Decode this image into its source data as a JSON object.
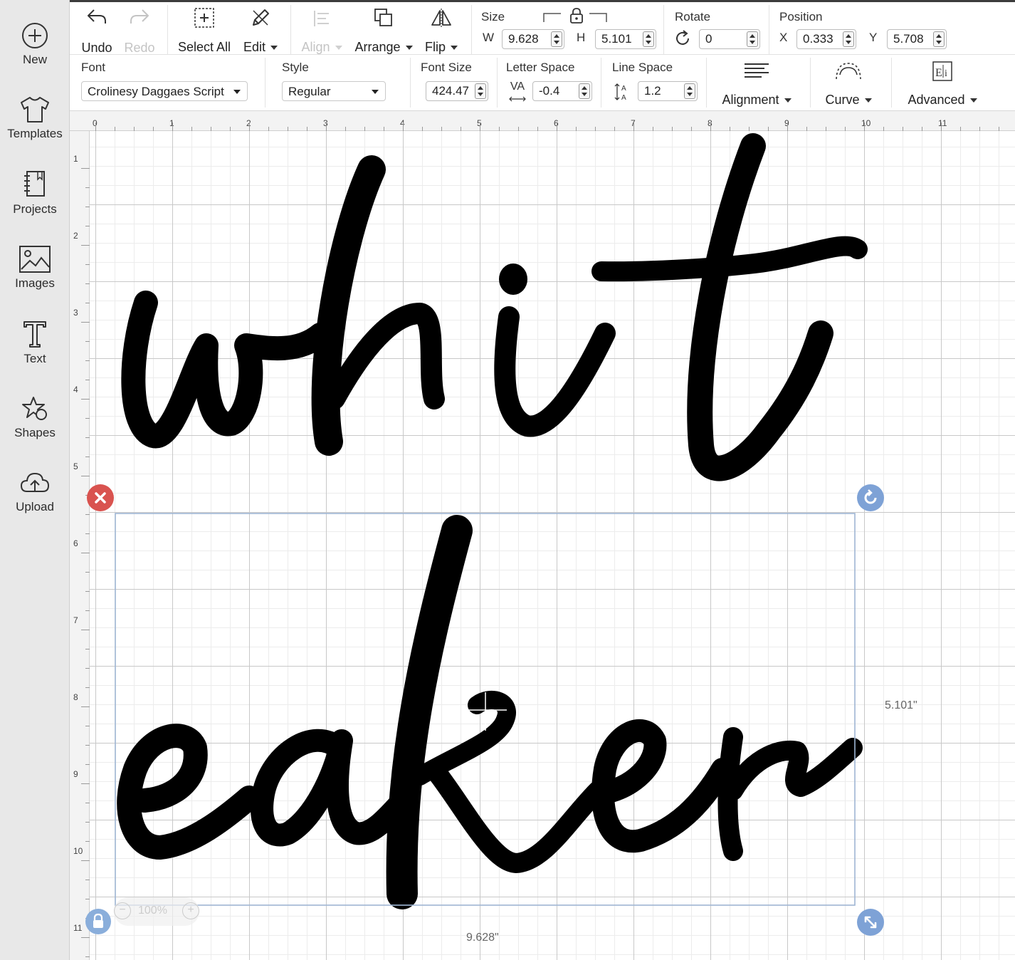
{
  "sidebar": {
    "items": [
      {
        "label": "New",
        "icon": "plus-circle-icon"
      },
      {
        "label": "Templates",
        "icon": "tshirt-icon"
      },
      {
        "label": "Projects",
        "icon": "notebook-icon"
      },
      {
        "label": "Images",
        "icon": "image-icon"
      },
      {
        "label": "Text",
        "icon": "text-t-icon"
      },
      {
        "label": "Shapes",
        "icon": "shapes-icon"
      },
      {
        "label": "Upload",
        "icon": "cloud-upload-icon"
      }
    ]
  },
  "toolbar": {
    "undo": "Undo",
    "redo": "Redo",
    "select_all": "Select All",
    "edit": "Edit",
    "align": "Align",
    "arrange": "Arrange",
    "flip": "Flip",
    "size": {
      "title": "Size",
      "w_label": "W",
      "w_value": "9.628",
      "h_label": "H",
      "h_value": "5.101",
      "lock_icon": "lock-icon"
    },
    "rotate": {
      "title": "Rotate",
      "value": "0"
    },
    "position": {
      "title": "Position",
      "x_label": "X",
      "x_value": "0.333",
      "y_label": "Y",
      "y_value": "5.708"
    }
  },
  "text_toolbar": {
    "font": {
      "title": "Font",
      "value": "Crolinesy Daggaes Script"
    },
    "style": {
      "title": "Style",
      "value": "Regular"
    },
    "font_size": {
      "title": "Font Size",
      "value": "424.47"
    },
    "letter_space": {
      "title": "Letter Space",
      "icon_text": "VA",
      "value": "-0.4"
    },
    "line_space": {
      "title": "Line Space",
      "value": "1.2"
    },
    "alignment": "Alignment",
    "curve": "Curve",
    "advanced": "Advanced"
  },
  "canvas": {
    "ruler_top": [
      "0",
      "1",
      "2",
      "3",
      "4",
      "5",
      "6",
      "7",
      "8",
      "9",
      "10",
      "11"
    ],
    "ruler_left": [
      "1",
      "2",
      "3",
      "4",
      "5",
      "6",
      "7",
      "8",
      "9",
      "10",
      "11"
    ],
    "text_line1": "whit",
    "text_line2": "eaker",
    "dim_height": "5.101\"",
    "dim_width": "9.628\"",
    "zoom": "100%",
    "colors": {
      "selection": "#9fb6d4",
      "delete": "#d9534f",
      "handle": "#7ea2d6",
      "text": "#000000"
    }
  }
}
